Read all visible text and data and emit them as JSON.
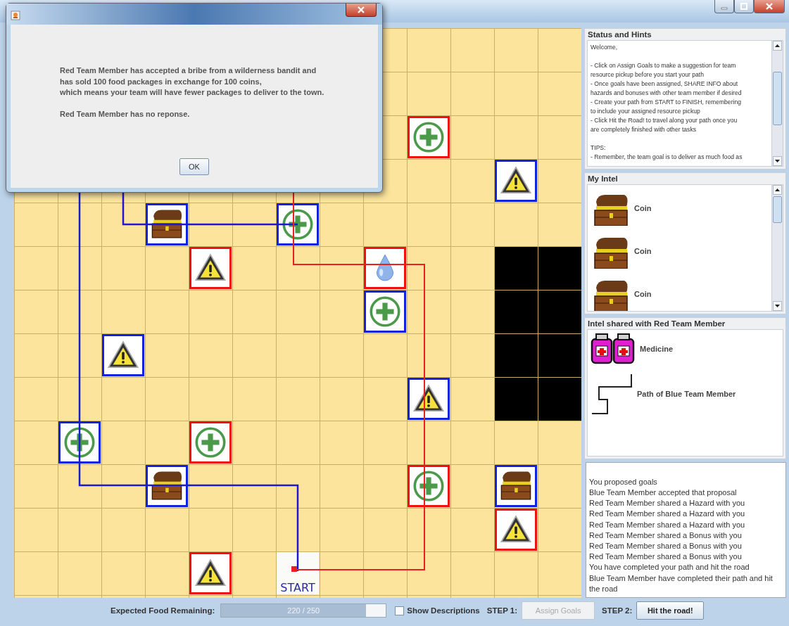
{
  "board": {
    "rows": [
      {
        "cells": [
          {
            "kind": "empty"
          },
          {
            "kind": "empty"
          },
          {
            "kind": "empty"
          },
          {
            "kind": "empty"
          },
          {
            "kind": "empty"
          },
          {
            "kind": "empty"
          },
          {
            "kind": "empty"
          },
          {
            "kind": "empty"
          },
          {
            "kind": "empty"
          },
          {
            "kind": "empty"
          },
          {
            "kind": "empty"
          },
          {
            "kind": "empty"
          },
          {
            "kind": "empty"
          }
        ]
      },
      {
        "cells": [
          {
            "kind": "empty"
          },
          {
            "kind": "empty"
          },
          {
            "kind": "empty"
          },
          {
            "kind": "empty"
          },
          {
            "kind": "empty"
          },
          {
            "kind": "empty"
          },
          {
            "kind": "empty"
          },
          {
            "kind": "empty"
          },
          {
            "kind": "empty"
          },
          {
            "kind": "empty"
          },
          {
            "kind": "empty"
          },
          {
            "kind": "empty"
          },
          {
            "kind": "empty"
          }
        ]
      },
      {
        "cells": [
          {
            "kind": "empty"
          },
          {
            "kind": "empty"
          },
          {
            "kind": "empty"
          },
          {
            "kind": "empty"
          },
          {
            "kind": "empty"
          },
          {
            "kind": "empty"
          },
          {
            "kind": "empty"
          },
          {
            "kind": "empty"
          },
          {
            "kind": "empty"
          },
          {
            "kind": "bonus",
            "color": "#ee1111"
          },
          {
            "kind": "empty"
          },
          {
            "kind": "empty"
          },
          {
            "kind": "empty"
          }
        ]
      },
      {
        "cells": [
          {
            "kind": "empty"
          },
          {
            "kind": "empty"
          },
          {
            "kind": "empty"
          },
          {
            "kind": "empty"
          },
          {
            "kind": "empty"
          },
          {
            "kind": "empty"
          },
          {
            "kind": "empty"
          },
          {
            "kind": "empty"
          },
          {
            "kind": "empty"
          },
          {
            "kind": "empty"
          },
          {
            "kind": "empty"
          },
          {
            "kind": "hazard",
            "color": "#1122dd"
          },
          {
            "kind": "empty"
          }
        ]
      },
      {
        "cells": [
          {
            "kind": "empty"
          },
          {
            "kind": "empty"
          },
          {
            "kind": "empty"
          },
          {
            "kind": "treasure",
            "color": "#1122dd"
          },
          {
            "kind": "empty"
          },
          {
            "kind": "empty"
          },
          {
            "kind": "bonus",
            "color": "#1122dd"
          },
          {
            "kind": "empty"
          },
          {
            "kind": "empty"
          },
          {
            "kind": "empty"
          },
          {
            "kind": "empty"
          },
          {
            "kind": "empty"
          },
          {
            "kind": "empty"
          }
        ]
      },
      {
        "cells": [
          {
            "kind": "empty"
          },
          {
            "kind": "empty"
          },
          {
            "kind": "empty"
          },
          {
            "kind": "empty"
          },
          {
            "kind": "hazard",
            "color": "#ee1111"
          },
          {
            "kind": "empty"
          },
          {
            "kind": "empty"
          },
          {
            "kind": "empty"
          },
          {
            "kind": "water",
            "color": "#ee1111"
          },
          {
            "kind": "empty"
          },
          {
            "kind": "empty"
          },
          {
            "kind": "blocked"
          },
          {
            "kind": "blocked"
          }
        ]
      },
      {
        "cells": [
          {
            "kind": "empty"
          },
          {
            "kind": "empty"
          },
          {
            "kind": "empty"
          },
          {
            "kind": "empty"
          },
          {
            "kind": "empty"
          },
          {
            "kind": "empty"
          },
          {
            "kind": "empty"
          },
          {
            "kind": "empty"
          },
          {
            "kind": "bonus",
            "color": "#1122dd"
          },
          {
            "kind": "empty"
          },
          {
            "kind": "empty"
          },
          {
            "kind": "blocked"
          },
          {
            "kind": "blocked"
          }
        ]
      },
      {
        "cells": [
          {
            "kind": "empty"
          },
          {
            "kind": "empty"
          },
          {
            "kind": "hazard",
            "color": "#1122dd"
          },
          {
            "kind": "empty"
          },
          {
            "kind": "empty"
          },
          {
            "kind": "empty"
          },
          {
            "kind": "empty"
          },
          {
            "kind": "empty"
          },
          {
            "kind": "empty"
          },
          {
            "kind": "empty"
          },
          {
            "kind": "empty"
          },
          {
            "kind": "blocked"
          },
          {
            "kind": "blocked"
          }
        ]
      },
      {
        "cells": [
          {
            "kind": "empty"
          },
          {
            "kind": "empty"
          },
          {
            "kind": "empty"
          },
          {
            "kind": "empty"
          },
          {
            "kind": "empty"
          },
          {
            "kind": "empty"
          },
          {
            "kind": "empty"
          },
          {
            "kind": "empty"
          },
          {
            "kind": "empty"
          },
          {
            "kind": "hazard",
            "color": "#1122dd"
          },
          {
            "kind": "empty"
          },
          {
            "kind": "blocked"
          },
          {
            "kind": "blocked"
          }
        ]
      },
      {
        "cells": [
          {
            "kind": "empty"
          },
          {
            "kind": "bonus",
            "color": "#1122dd"
          },
          {
            "kind": "empty"
          },
          {
            "kind": "empty"
          },
          {
            "kind": "bonus",
            "color": "#ee1111"
          },
          {
            "kind": "empty"
          },
          {
            "kind": "empty"
          },
          {
            "kind": "empty"
          },
          {
            "kind": "empty"
          },
          {
            "kind": "empty"
          },
          {
            "kind": "empty"
          },
          {
            "kind": "empty"
          },
          {
            "kind": "empty"
          }
        ]
      },
      {
        "cells": [
          {
            "kind": "empty"
          },
          {
            "kind": "empty"
          },
          {
            "kind": "empty"
          },
          {
            "kind": "treasure",
            "color": "#1122dd"
          },
          {
            "kind": "empty"
          },
          {
            "kind": "empty"
          },
          {
            "kind": "empty"
          },
          {
            "kind": "empty"
          },
          {
            "kind": "empty"
          },
          {
            "kind": "bonus",
            "color": "#ee1111"
          },
          {
            "kind": "empty"
          },
          {
            "kind": "treasure",
            "color": "#1122dd"
          },
          {
            "kind": "empty"
          }
        ]
      },
      {
        "cells": [
          {
            "kind": "empty"
          },
          {
            "kind": "empty"
          },
          {
            "kind": "empty"
          },
          {
            "kind": "empty"
          },
          {
            "kind": "empty"
          },
          {
            "kind": "empty"
          },
          {
            "kind": "empty"
          },
          {
            "kind": "empty"
          },
          {
            "kind": "empty"
          },
          {
            "kind": "empty"
          },
          {
            "kind": "empty"
          },
          {
            "kind": "hazard",
            "color": "#ee1111"
          },
          {
            "kind": "empty"
          }
        ]
      },
      {
        "cells": [
          {
            "kind": "empty"
          },
          {
            "kind": "empty"
          },
          {
            "kind": "empty"
          },
          {
            "kind": "empty"
          },
          {
            "kind": "hazard",
            "color": "#ee1111"
          },
          {
            "kind": "empty"
          },
          {
            "kind": "start",
            "label": "START"
          },
          {
            "kind": "empty"
          },
          {
            "kind": "empty"
          },
          {
            "kind": "empty"
          },
          {
            "kind": "empty"
          },
          {
            "kind": "empty"
          },
          {
            "kind": "empty"
          }
        ]
      }
    ]
  },
  "status_hints": {
    "title": "Status and Hints",
    "paragraphs": [
      [
        "Welcome,"
      ],
      [
        "- Click on Assign Goals to make a suggestion for team",
        "resource pickup before you start your path",
        "- Once goals have been assigned, SHARE INFO about",
        "hazards and bonuses with other team member if desired",
        "- Create your path from START to FINISH, remembering",
        "to include your assigned resource pickup",
        "- Click Hit the Road! to travel along your path once you",
        "are completely finished with other tasks"
      ],
      [
        "TIPS:",
        "- Remember, the team goal is to deliver as much food as"
      ]
    ]
  },
  "my_intel": {
    "title": "My Intel",
    "items": [
      {
        "kind": "coin",
        "label": "Coin"
      },
      {
        "kind": "coin",
        "label": "Coin"
      },
      {
        "kind": "coin",
        "label": "Coin"
      }
    ]
  },
  "shared_intel": {
    "title": "Intel shared with Red Team Member",
    "items": [
      {
        "kind": "medicine",
        "label": "Medicine"
      },
      {
        "kind": "path",
        "label": "Path of Blue Team Member"
      }
    ]
  },
  "log": {
    "lines": [
      "You proposed goals",
      "Blue Team Member accepted that proposal",
      "Red Team Member shared a Hazard with you",
      "Red Team Member shared a Hazard with you",
      "Red Team Member shared a Hazard with you",
      "Red Team Member shared a Bonus with you",
      "Red Team Member shared a Bonus with you",
      "Red Team Member shared a Bonus with you",
      "You have completed your path and hit the road",
      "Blue Team Member have completed their path and hit the road"
    ]
  },
  "bottom_bar": {
    "food_label": "Expected Food Remaining:",
    "food_reading": "220 / 250",
    "level": 0.88,
    "show_descriptions": {
      "label": "Show Descriptions",
      "checked": false
    },
    "step1_label": "STEP 1:",
    "assign_button": {
      "label": "Assign Goals",
      "disabled": true
    },
    "step2_label": "STEP 2:",
    "road_button": {
      "label": "Hit the road!",
      "disabled": false
    }
  },
  "dialog": {
    "paragraphs": [
      [
        "Red Team Member has accepted a bribe from a wilderness bandit and",
        "has sold 100 food packages in exchange for 100 coins,",
        "which means your team will have fewer packages to deliver to the town."
      ],
      [
        "Red Team Member has no reponse."
      ]
    ],
    "button": "OK"
  }
}
